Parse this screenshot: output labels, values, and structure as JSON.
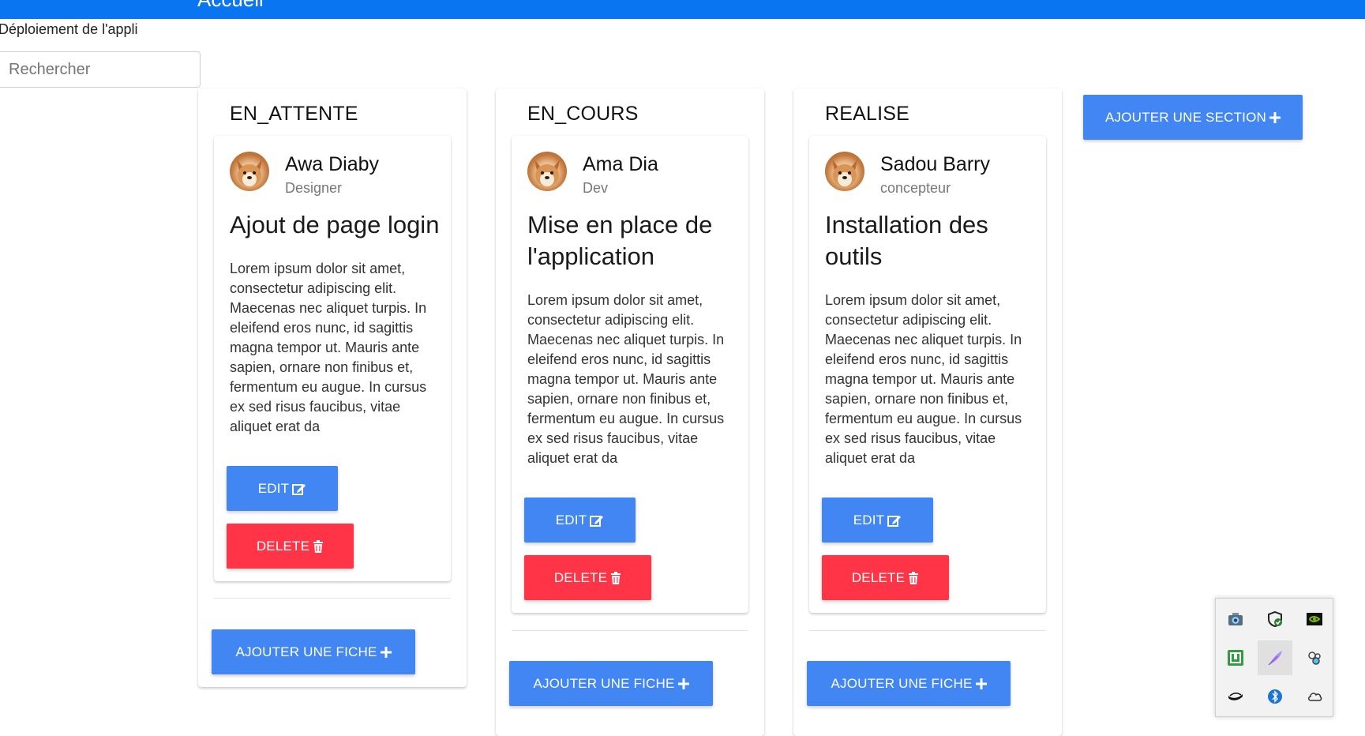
{
  "header": {
    "title": "Accueil",
    "background": "#0a75f0"
  },
  "page": {
    "subtitle": "Déploiement de l'appli"
  },
  "search": {
    "placeholder": "Rechercher",
    "value": ""
  },
  "columns": [
    {
      "title": "EN_ATTENTE",
      "card": {
        "name": "Awa Diaby",
        "role": "Designer",
        "title": "Ajout de page login",
        "text": "Lorem ipsum dolor sit amet, consectetur adipiscing elit. Maecenas nec aliquet turpis. In eleifend eros nunc, id sagittis magna tempor ut. Mauris ante sapien, ornare non finibus et, fermentum eu augue. In cursus ex sed risus faucibus, vitae aliquet erat da",
        "edit_label": "EDIT",
        "delete_label": "DELETE"
      },
      "add_card_label": "AJOUTER UNE FICHE"
    },
    {
      "title": "EN_COURS",
      "card": {
        "name": "Ama Dia",
        "role": "Dev",
        "title": "Mise en place de l'application",
        "text": "Lorem ipsum dolor sit amet, consectetur adipiscing elit. Maecenas nec aliquet turpis. In eleifend eros nunc, id sagittis magna tempor ut. Mauris ante sapien, ornare non finibus et, fermentum eu augue. In cursus ex sed risus faucibus, vitae aliquet erat da",
        "edit_label": "EDIT",
        "delete_label": "DELETE"
      },
      "add_card_label": "AJOUTER UNE FICHE"
    },
    {
      "title": "REALISE",
      "card": {
        "name": "Sadou Barry",
        "role": "concepteur",
        "title": "Installation des outils",
        "text": "Lorem ipsum dolor sit amet, consectetur adipiscing elit. Maecenas nec aliquet turpis. In eleifend eros nunc, id sagittis magna tempor ut. Mauris ante sapien, ornare non finibus et, fermentum eu augue. In cursus ex sed risus faucibus, vitae aliquet erat da",
        "edit_label": "EDIT",
        "delete_label": "DELETE"
      },
      "add_card_label": "AJOUTER UNE FICHE"
    }
  ],
  "add_section_label": "AJOUTER UNE SECTION",
  "colors": {
    "primary_button": "#4286f4",
    "danger_button": "#ff3547"
  },
  "tray": {
    "icons": [
      "network-camera-icon",
      "security-shield-icon",
      "nvidia-icon",
      "green-app-icon",
      "feather-icon",
      "bubbles-icon",
      "lamp-icon",
      "bluetooth-icon",
      "cloud-icon"
    ]
  }
}
